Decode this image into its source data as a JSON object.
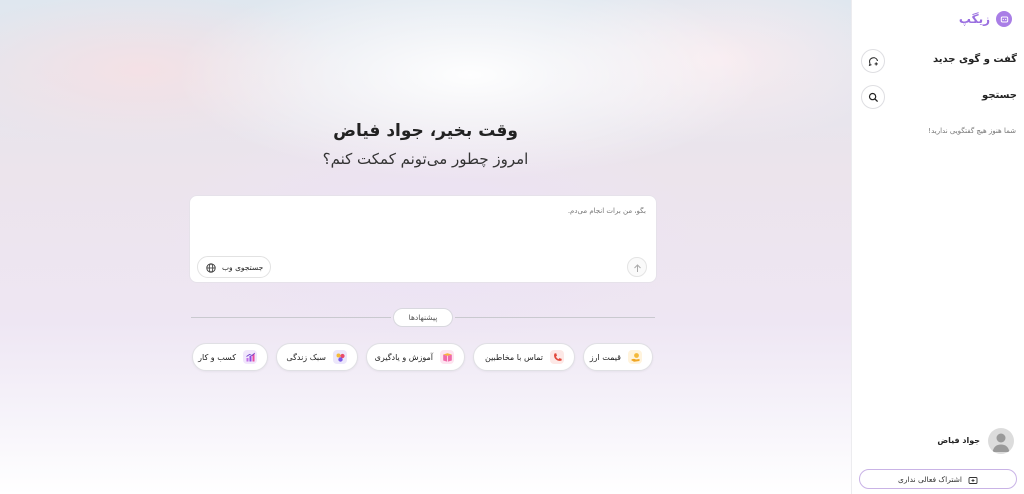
{
  "main": {
    "greeting_title": "وقت بخیر، جواد فیاض",
    "greeting_subtitle": "امروز چطور می‌تونم کمکت کنم؟",
    "composer": {
      "placeholder": "بگو، من برات انجام می‌دم.",
      "web_search_label": "جستجوی وب"
    },
    "suggestions_label": "پیشنهادها",
    "suggestions": [
      {
        "label": "قیمت ارز",
        "icon": "hand-coin-icon",
        "color": "#f4b93a"
      },
      {
        "label": "تماس با مخاطبین",
        "icon": "phone-icon",
        "color": "#e2483b"
      },
      {
        "label": "آموزش و یادگیری",
        "icon": "book-icon",
        "color": "#e94ba0"
      },
      {
        "label": "سبک زندگی",
        "icon": "lifestyle-icon",
        "color": "#7b5be6"
      },
      {
        "label": "کسب و کار",
        "icon": "chart-icon",
        "color": "#8e4be3"
      }
    ]
  },
  "sidebar": {
    "brand": "زیگپ",
    "brand_color": "#9a6fe0",
    "new_chat_label": "گفت و گوی جدید",
    "search_label": "جستجو",
    "empty_note": "شما هنوز هیچ گفتگویی ندارید!",
    "user_name": "جواد فیاض",
    "subscription_label": "اشتراک فعالی نداری"
  }
}
